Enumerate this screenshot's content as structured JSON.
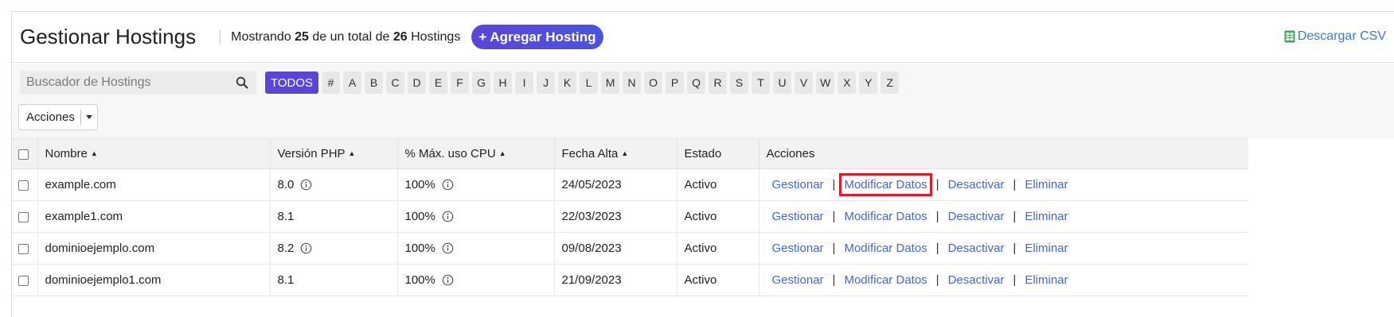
{
  "header": {
    "title": "Gestionar Hostings",
    "showing_prefix": "Mostrando",
    "showing_count": "25",
    "showing_mid": "de un total de",
    "showing_total": "26",
    "showing_suffix": "Hostings",
    "add_button": "+ Agregar Hosting",
    "csv_link": "Descargar CSV"
  },
  "search": {
    "placeholder": "Buscador de Hostings"
  },
  "letters": [
    "TODOS",
    "#",
    "A",
    "B",
    "C",
    "D",
    "E",
    "F",
    "G",
    "H",
    "I",
    "J",
    "K",
    "L",
    "M",
    "N",
    "O",
    "P",
    "Q",
    "R",
    "S",
    "T",
    "U",
    "V",
    "W",
    "X",
    "Y",
    "Z"
  ],
  "actions_dropdown": {
    "label": "Acciones"
  },
  "table": {
    "headers": {
      "name": "Nombre",
      "php": "Versión PHP",
      "cpu": "% Máx. uso CPU",
      "date": "Fecha Alta",
      "status": "Estado",
      "actions": "Acciones"
    },
    "action_labels": {
      "manage": "Gestionar",
      "modify": "Modificar Datos",
      "deactivate": "Desactivar",
      "delete": "Eliminar",
      "separator": "|"
    },
    "rows": [
      {
        "name": "example.com",
        "php": "8.0",
        "php_info": true,
        "cpu": "100%",
        "date": "24/05/2023",
        "status": "Activo"
      },
      {
        "name": "example1.com",
        "php": "8.1",
        "php_info": false,
        "cpu": "100%",
        "date": "22/03/2023",
        "status": "Activo"
      },
      {
        "name": "dominioejemplo.com",
        "php": "8.2",
        "php_info": true,
        "cpu": "100%",
        "date": "09/08/2023",
        "status": "Activo"
      },
      {
        "name": "dominioejemplo1.com",
        "php": "8.1",
        "php_info": false,
        "cpu": "100%",
        "date": "21/09/2023",
        "status": "Activo"
      }
    ]
  },
  "colors": {
    "accent": "#5b45d9",
    "link": "#4567d6",
    "highlight_box": "#e0192c"
  }
}
